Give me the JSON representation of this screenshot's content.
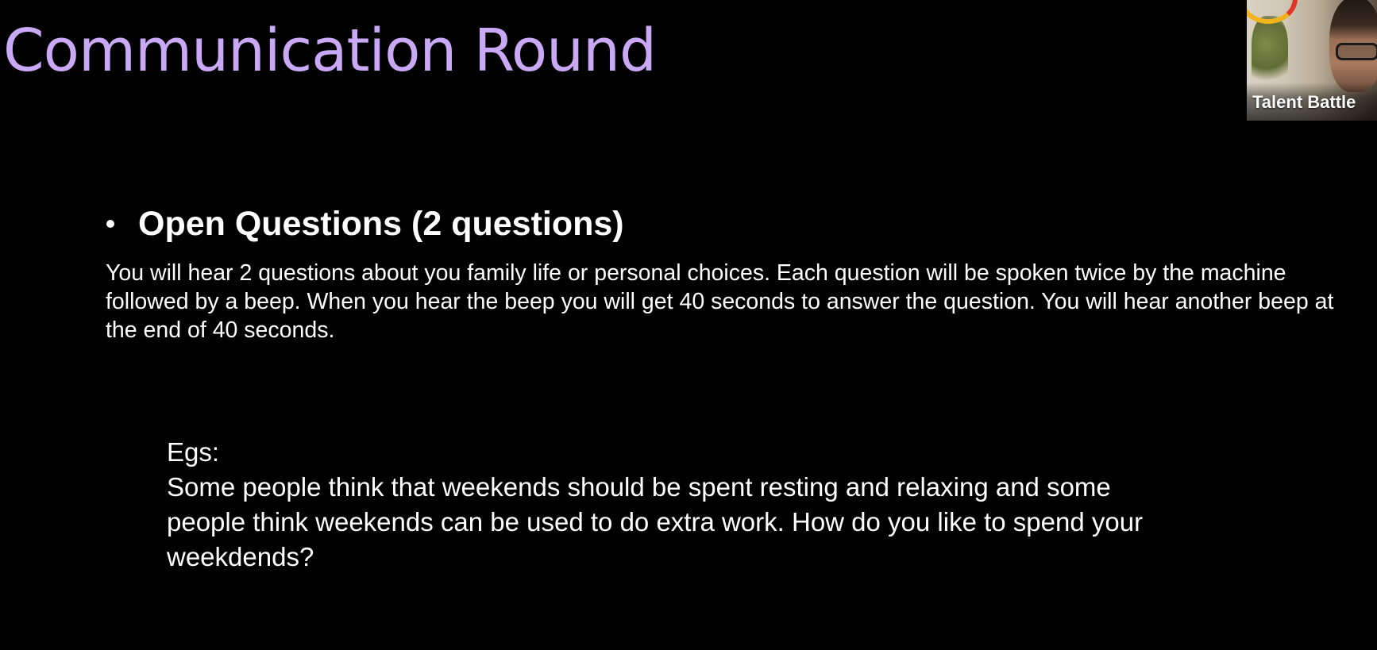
{
  "slide": {
    "title": "Communication Round",
    "bullet_heading": "Open Questions (2 questions)",
    "body": "You will hear 2 questions about you family life or personal choices. Each question will be spoken twice by the machine followed by a beep. When you hear the beep you will get 40 seconds to answer the question. You will hear another beep at the end of 40 seconds.",
    "example_label": "Egs:",
    "example_text": "Some people think that weekends should be spent resting and relaxing and some people think weekends can be used to do extra work. How do you like to spend your weekdends?"
  },
  "webcam": {
    "participant_name": "Talent Battle"
  },
  "colors": {
    "background": "#000000",
    "title": "#c9a9f5",
    "text": "#ffffff"
  }
}
